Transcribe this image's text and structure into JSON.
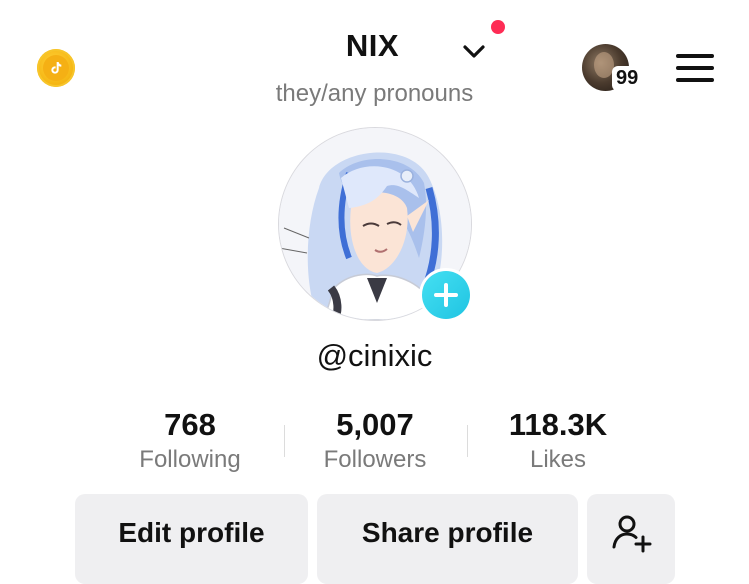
{
  "header": {
    "title": "NIX",
    "pronouns": "they/any pronouns",
    "notification_badge": "99",
    "accent_color": "#fe2c55"
  },
  "profile": {
    "username": "@cinixic"
  },
  "stats": [
    {
      "value": "768",
      "label": "Following"
    },
    {
      "value": "5,007",
      "label": "Followers"
    },
    {
      "value": "118.3K",
      "label": "Likes"
    }
  ],
  "actions": {
    "edit_label": "Edit profile",
    "share_label": "Share profile"
  },
  "icons": {
    "coin": "tiktok-coin-icon",
    "dropdown": "chevron-down-icon",
    "menu": "hamburger-menu-icon",
    "add": "plus-icon",
    "add_friend": "add-user-icon"
  },
  "colors": {
    "add_button": "#20c4e2",
    "coin": "#f6b816",
    "button_bg": "#efeff1",
    "muted_text": "#7a7a7a"
  }
}
